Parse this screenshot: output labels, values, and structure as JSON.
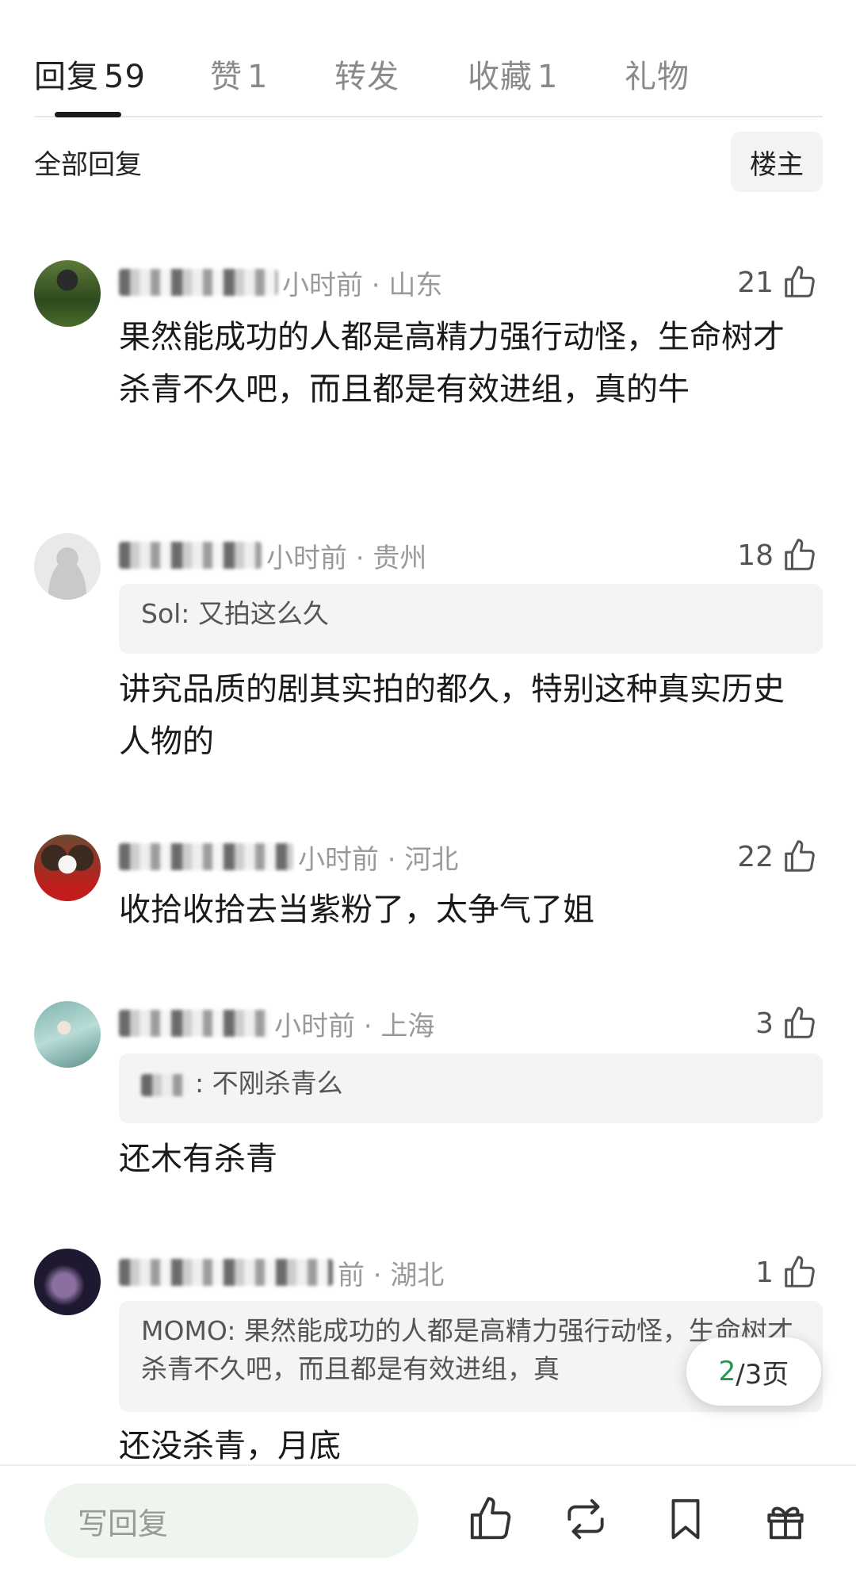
{
  "tabs": [
    {
      "label": "回复",
      "count": "59"
    },
    {
      "label": "赞",
      "count": "1"
    },
    {
      "label": "转发",
      "count": ""
    },
    {
      "label": "收藏",
      "count": "1"
    },
    {
      "label": "礼物",
      "count": ""
    }
  ],
  "sub_header": {
    "title": "全部回复",
    "owner_filter": "楼主"
  },
  "comments": [
    {
      "meta": "小时前 · 山东",
      "likes": "21",
      "quote": "",
      "text": "果然能成功的人都是高精力强行动怪，生命树才杀青不久吧，而且都是有效进组，真的牛"
    },
    {
      "meta": "小时前 · 贵州",
      "likes": "18",
      "quote": "Sol: 又拍这么久",
      "text": "讲究品质的剧其实拍的都久，特别这种真实历史人物的"
    },
    {
      "meta": "小时前 · 河北",
      "likes": "22",
      "quote": "",
      "text": "收拾收拾去当紫粉了，太争气了姐"
    },
    {
      "meta": "小时前 · 上海",
      "likes": "3",
      "quote": ": 不刚杀青么",
      "text": "还木有杀青"
    },
    {
      "meta": "前 · 湖北",
      "likes": "1",
      "quote": "MOMO: 果然能成功的人都是高精力强行动怪，生命树才杀青不久吧，而且都是有效进组，真",
      "text": "还没杀青，月底"
    }
  ],
  "pager": {
    "current": "2",
    "rest": "/3页"
  },
  "bottom_bar": {
    "reply_placeholder": "写回复"
  },
  "colors": {
    "accent_green": "#1e9a4b",
    "quote_bg": "#f4f4f4"
  }
}
